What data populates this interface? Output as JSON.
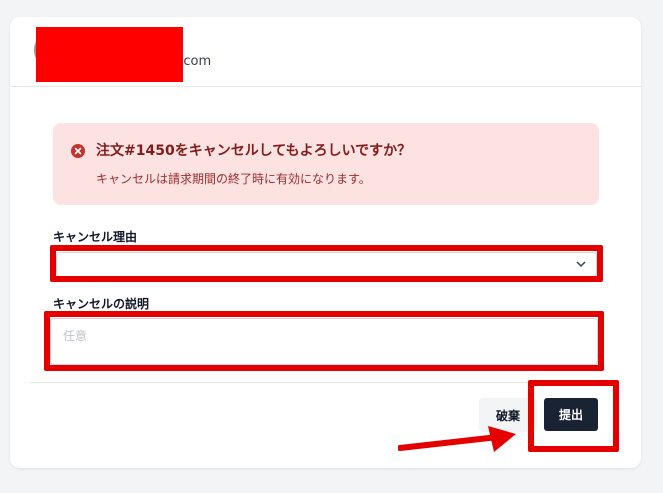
{
  "user": {
    "email_visible": "il.com"
  },
  "alert": {
    "title": "注文#1450をキャンセルしてもよろしいですか？",
    "message": "キャンセルは請求期間の終了時に有効になります。",
    "icon": "x-circle-icon",
    "color": "#c53030"
  },
  "form": {
    "reason_label": "キャンセル理由",
    "reason_value": "",
    "description_label": "キャンセルの説明",
    "description_placeholder": "任意"
  },
  "actions": {
    "discard_label": "破棄",
    "submit_label": "提出"
  },
  "colors": {
    "annotation_red": "#e50000",
    "submit_bg": "#1a2333",
    "alert_bg": "#fde2e2"
  }
}
